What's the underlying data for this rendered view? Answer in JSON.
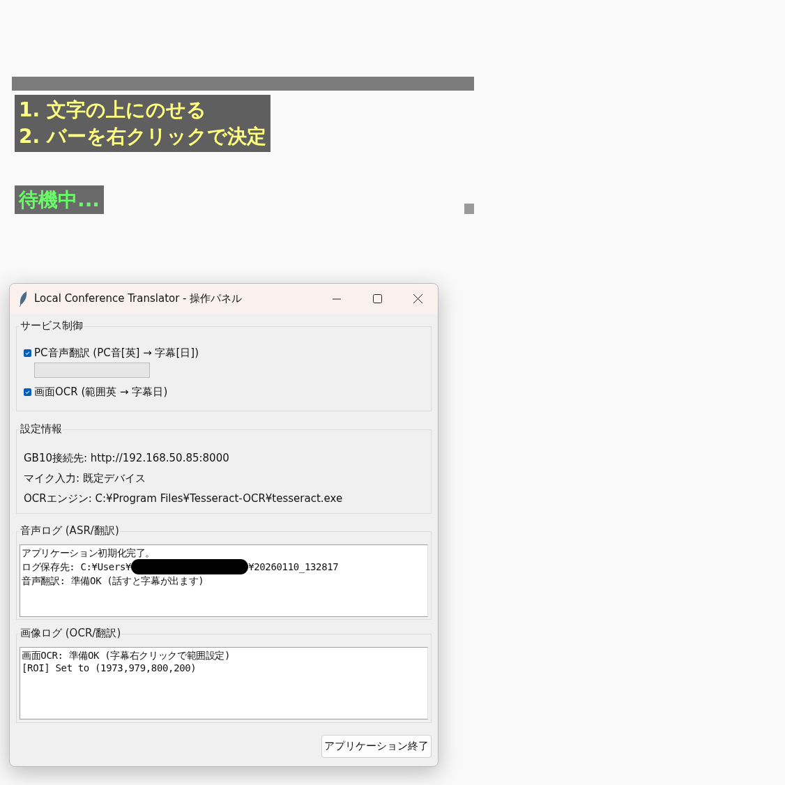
{
  "overlay": {
    "instructions": [
      "1. 文字の上にのせる",
      "2. バーを右クリックで決定"
    ],
    "status": "待機中..."
  },
  "window": {
    "title": "Local Conference Translator - 操作パネル"
  },
  "service_control": {
    "title": "サービス制御",
    "options": [
      {
        "label": "PC音声翻訳 (PC音[英] → 字幕[日])",
        "checked": true,
        "level": 0
      },
      {
        "label": "画面OCR (範囲英 → 字幕日)",
        "checked": true
      }
    ]
  },
  "settings_info": {
    "title": "設定情報",
    "lines": [
      "GB10接続先: http://192.168.50.85:8000",
      "マイク入力: 既定デバイス",
      "OCRエンジン: C:¥Program Files¥Tesseract-OCR¥tesseract.exe"
    ]
  },
  "audio_log": {
    "title": "音声ログ (ASR/翻訳)",
    "lines": [
      {
        "text": "アプリケーション初期化完了。"
      },
      {
        "text": "ログ保存先: C:¥Users¥",
        "redacted": true,
        "after": "¥20260110_132817"
      },
      {
        "text": "音声翻訳: 準備OK (話すと字幕が出ます)"
      }
    ]
  },
  "image_log": {
    "title": "画像ログ (OCR/翻訳)",
    "lines": [
      {
        "text": "画面OCR: 準備OK (字幕右クリックで範囲設定)"
      },
      {
        "text": "[ROI] Set to (1973,979,800,200)"
      }
    ]
  },
  "buttons": [
    "アプリケーション終了"
  ]
}
